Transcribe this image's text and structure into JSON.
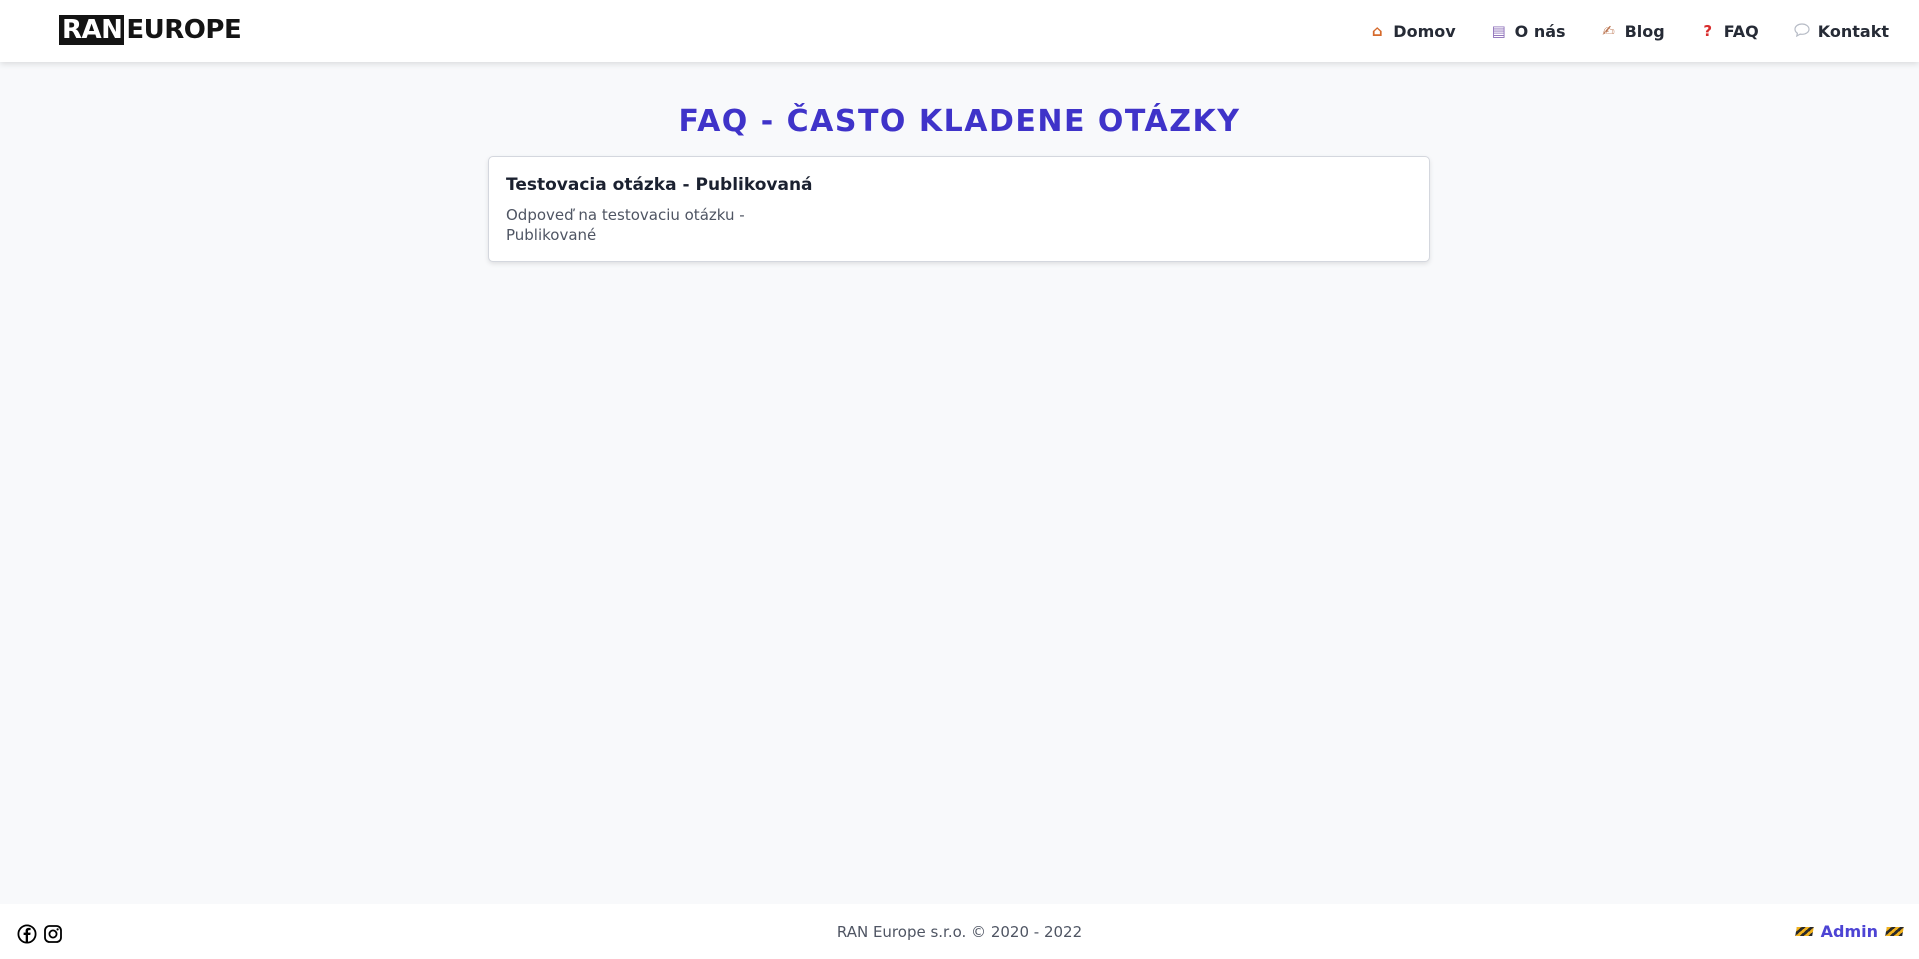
{
  "header": {
    "logo": {
      "box": "RAN",
      "text": "EUROPE"
    },
    "nav": [
      {
        "label": "Domov",
        "icon": "house-icon"
      },
      {
        "label": "O nás",
        "icon": "page-icon"
      },
      {
        "label": "Blog",
        "icon": "writing-hand-icon"
      },
      {
        "label": "FAQ",
        "icon": "question-mark-icon"
      },
      {
        "label": "Kontakt",
        "icon": "speech-bubble-icon"
      }
    ]
  },
  "main": {
    "title": "FAQ - ČASTO KLADENE OTÁZKY",
    "faqs": [
      {
        "question": "Testovacia otázka - Publikovaná",
        "answer": "Odpoveď na testovaciu otázku - Publikované"
      }
    ]
  },
  "footer": {
    "social": [
      "facebook-icon",
      "instagram-icon"
    ],
    "copyright": "RAN Europe s.r.o. © 2020 - 2022",
    "admin_label": "Admin"
  },
  "colors": {
    "accent": "#3f33c9",
    "admin_link": "#4d44d4",
    "background": "#f8f9fb"
  }
}
